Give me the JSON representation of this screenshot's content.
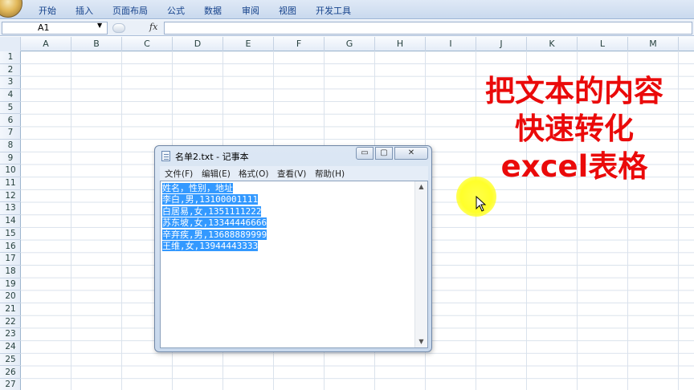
{
  "ribbon": {
    "tabs": [
      "开始",
      "插入",
      "页面布局",
      "公式",
      "数据",
      "审阅",
      "视图",
      "开发工具"
    ]
  },
  "formula_bar": {
    "name_box": "A1",
    "fx_label": "fx",
    "formula_value": ""
  },
  "grid": {
    "columns": [
      "A",
      "B",
      "C",
      "D",
      "E",
      "F",
      "G",
      "H",
      "I",
      "J",
      "K",
      "L",
      "M"
    ],
    "rows": [
      "1",
      "2",
      "3",
      "4",
      "5",
      "6",
      "7",
      "8",
      "9",
      "10",
      "11",
      "12",
      "13",
      "14",
      "15",
      "16",
      "17",
      "18",
      "19",
      "20",
      "21",
      "22",
      "23",
      "24",
      "25",
      "26",
      "27"
    ]
  },
  "overlay": {
    "lines": [
      "把文本的内容",
      "快速转化",
      "excel表格"
    ],
    "color": "#ea0a0a"
  },
  "notepad": {
    "title": "名单2.txt - 记事本",
    "window_buttons": {
      "minimize": "▭",
      "maximize": "▢",
      "close": "✕"
    },
    "menus": [
      "文件(F)",
      "编辑(E)",
      "格式(O)",
      "查看(V)",
      "帮助(H)"
    ],
    "lines": [
      "姓名，性别，地址",
      "李白,男,13100001111",
      "白居易,女,1351111222",
      "苏东坡,女,13344446666",
      "辛弃疾,男,13688889999",
      "王维,女,13944443333"
    ],
    "selection_color": "#3399ff"
  },
  "icons": {
    "office_button": "office-logo-icon",
    "cursor": "mouse-pointer-icon"
  }
}
